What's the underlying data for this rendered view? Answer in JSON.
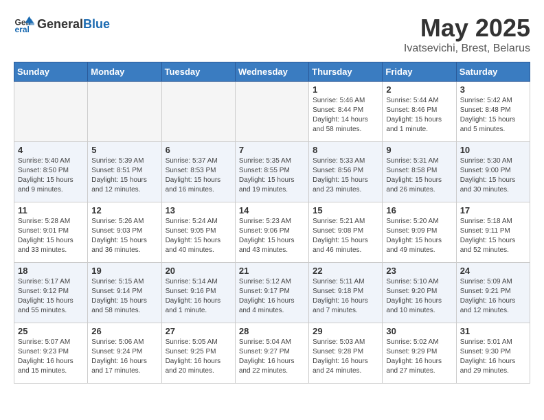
{
  "header": {
    "logo_general": "General",
    "logo_blue": "Blue",
    "month_year": "May 2025",
    "location": "Ivatsevichi, Brest, Belarus"
  },
  "weekdays": [
    "Sunday",
    "Monday",
    "Tuesday",
    "Wednesday",
    "Thursday",
    "Friday",
    "Saturday"
  ],
  "weeks": [
    [
      {
        "day": "",
        "info": "",
        "empty": true
      },
      {
        "day": "",
        "info": "",
        "empty": true
      },
      {
        "day": "",
        "info": "",
        "empty": true
      },
      {
        "day": "",
        "info": "",
        "empty": true
      },
      {
        "day": "1",
        "info": "Sunrise: 5:46 AM\nSunset: 8:44 PM\nDaylight: 14 hours\nand 58 minutes."
      },
      {
        "day": "2",
        "info": "Sunrise: 5:44 AM\nSunset: 8:46 PM\nDaylight: 15 hours\nand 1 minute."
      },
      {
        "day": "3",
        "info": "Sunrise: 5:42 AM\nSunset: 8:48 PM\nDaylight: 15 hours\nand 5 minutes."
      }
    ],
    [
      {
        "day": "4",
        "info": "Sunrise: 5:40 AM\nSunset: 8:50 PM\nDaylight: 15 hours\nand 9 minutes."
      },
      {
        "day": "5",
        "info": "Sunrise: 5:39 AM\nSunset: 8:51 PM\nDaylight: 15 hours\nand 12 minutes."
      },
      {
        "day": "6",
        "info": "Sunrise: 5:37 AM\nSunset: 8:53 PM\nDaylight: 15 hours\nand 16 minutes."
      },
      {
        "day": "7",
        "info": "Sunrise: 5:35 AM\nSunset: 8:55 PM\nDaylight: 15 hours\nand 19 minutes."
      },
      {
        "day": "8",
        "info": "Sunrise: 5:33 AM\nSunset: 8:56 PM\nDaylight: 15 hours\nand 23 minutes."
      },
      {
        "day": "9",
        "info": "Sunrise: 5:31 AM\nSunset: 8:58 PM\nDaylight: 15 hours\nand 26 minutes."
      },
      {
        "day": "10",
        "info": "Sunrise: 5:30 AM\nSunset: 9:00 PM\nDaylight: 15 hours\nand 30 minutes."
      }
    ],
    [
      {
        "day": "11",
        "info": "Sunrise: 5:28 AM\nSunset: 9:01 PM\nDaylight: 15 hours\nand 33 minutes."
      },
      {
        "day": "12",
        "info": "Sunrise: 5:26 AM\nSunset: 9:03 PM\nDaylight: 15 hours\nand 36 minutes."
      },
      {
        "day": "13",
        "info": "Sunrise: 5:24 AM\nSunset: 9:05 PM\nDaylight: 15 hours\nand 40 minutes."
      },
      {
        "day": "14",
        "info": "Sunrise: 5:23 AM\nSunset: 9:06 PM\nDaylight: 15 hours\nand 43 minutes."
      },
      {
        "day": "15",
        "info": "Sunrise: 5:21 AM\nSunset: 9:08 PM\nDaylight: 15 hours\nand 46 minutes."
      },
      {
        "day": "16",
        "info": "Sunrise: 5:20 AM\nSunset: 9:09 PM\nDaylight: 15 hours\nand 49 minutes."
      },
      {
        "day": "17",
        "info": "Sunrise: 5:18 AM\nSunset: 9:11 PM\nDaylight: 15 hours\nand 52 minutes."
      }
    ],
    [
      {
        "day": "18",
        "info": "Sunrise: 5:17 AM\nSunset: 9:12 PM\nDaylight: 15 hours\nand 55 minutes."
      },
      {
        "day": "19",
        "info": "Sunrise: 5:15 AM\nSunset: 9:14 PM\nDaylight: 15 hours\nand 58 minutes."
      },
      {
        "day": "20",
        "info": "Sunrise: 5:14 AM\nSunset: 9:16 PM\nDaylight: 16 hours\nand 1 minute."
      },
      {
        "day": "21",
        "info": "Sunrise: 5:12 AM\nSunset: 9:17 PM\nDaylight: 16 hours\nand 4 minutes."
      },
      {
        "day": "22",
        "info": "Sunrise: 5:11 AM\nSunset: 9:18 PM\nDaylight: 16 hours\nand 7 minutes."
      },
      {
        "day": "23",
        "info": "Sunrise: 5:10 AM\nSunset: 9:20 PM\nDaylight: 16 hours\nand 10 minutes."
      },
      {
        "day": "24",
        "info": "Sunrise: 5:09 AM\nSunset: 9:21 PM\nDaylight: 16 hours\nand 12 minutes."
      }
    ],
    [
      {
        "day": "25",
        "info": "Sunrise: 5:07 AM\nSunset: 9:23 PM\nDaylight: 16 hours\nand 15 minutes."
      },
      {
        "day": "26",
        "info": "Sunrise: 5:06 AM\nSunset: 9:24 PM\nDaylight: 16 hours\nand 17 minutes."
      },
      {
        "day": "27",
        "info": "Sunrise: 5:05 AM\nSunset: 9:25 PM\nDaylight: 16 hours\nand 20 minutes."
      },
      {
        "day": "28",
        "info": "Sunrise: 5:04 AM\nSunset: 9:27 PM\nDaylight: 16 hours\nand 22 minutes."
      },
      {
        "day": "29",
        "info": "Sunrise: 5:03 AM\nSunset: 9:28 PM\nDaylight: 16 hours\nand 24 minutes."
      },
      {
        "day": "30",
        "info": "Sunrise: 5:02 AM\nSunset: 9:29 PM\nDaylight: 16 hours\nand 27 minutes."
      },
      {
        "day": "31",
        "info": "Sunrise: 5:01 AM\nSunset: 9:30 PM\nDaylight: 16 hours\nand 29 minutes."
      }
    ]
  ]
}
